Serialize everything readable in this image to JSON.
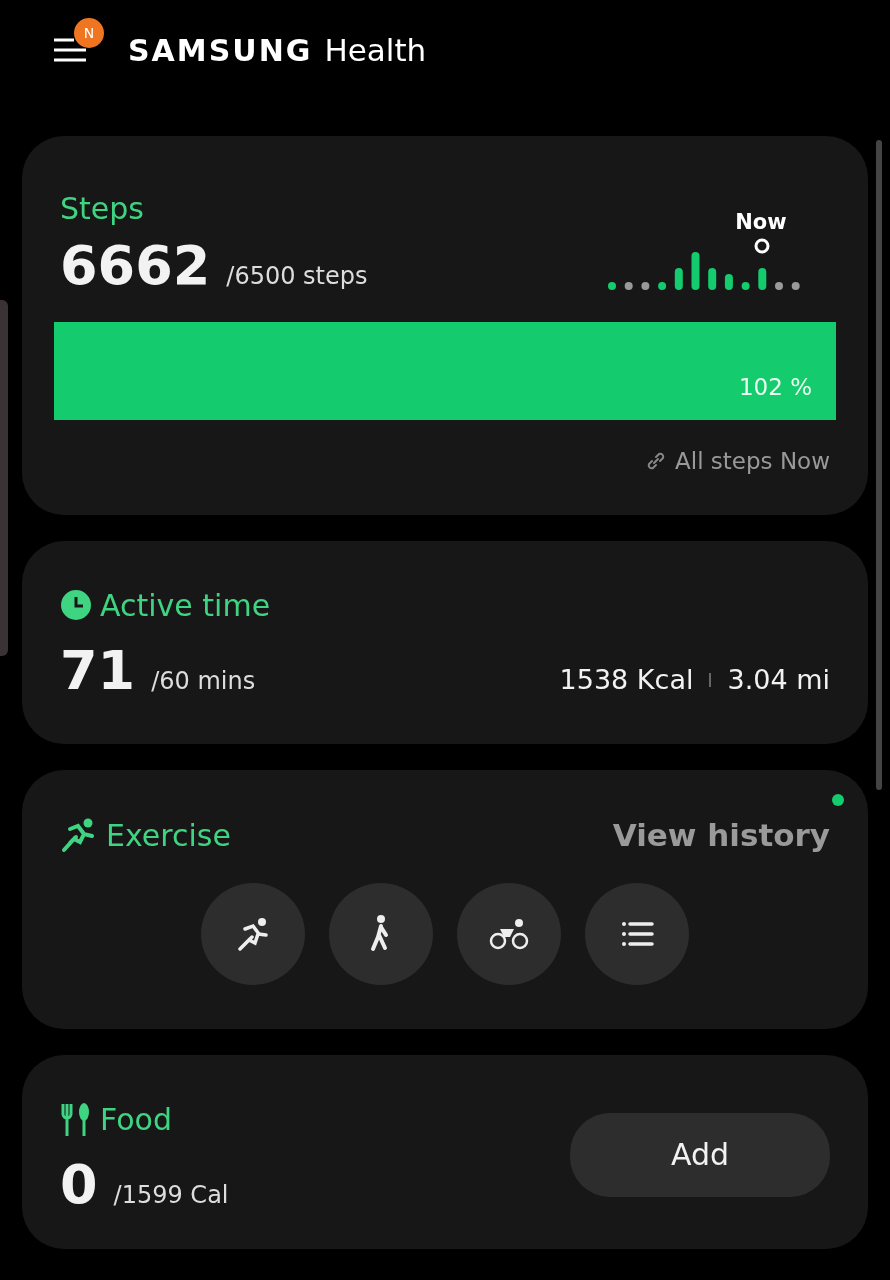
{
  "header": {
    "badge": "N",
    "brand": "SAMSUNG",
    "app": "Health"
  },
  "steps": {
    "title": "Steps",
    "count": "6662",
    "goal": "/6500 steps",
    "now_label": "Now",
    "progress": {
      "level": 1,
      "reading": "102 %"
    },
    "link": "All steps Now"
  },
  "active_time": {
    "title": "Active time",
    "value": "71",
    "goal": "/60 mins",
    "calories": "1538 Kcal",
    "distance": "3.04 mi"
  },
  "exercise": {
    "title": "Exercise",
    "link": "View history",
    "new_dot": true,
    "buttons": [
      {
        "kind": "run"
      },
      {
        "kind": "walk"
      },
      {
        "kind": "bike"
      },
      {
        "kind": "list"
      }
    ]
  },
  "food": {
    "title": "Food",
    "value": "0",
    "goal": "/1599 Cal",
    "button": "Add"
  }
}
